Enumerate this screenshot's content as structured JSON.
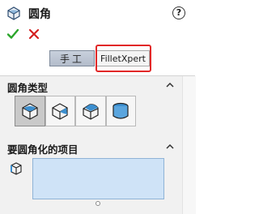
{
  "header": {
    "title": "圆角",
    "help_icon": "?",
    "title_icon": "fillet-feature-icon"
  },
  "actions": {
    "ok_icon": "checkmark-icon",
    "cancel_icon": "x-icon",
    "ok_color": "#2aa52a",
    "cancel_color": "#d42020"
  },
  "tabs": [
    {
      "label": "手工",
      "selected": true
    },
    {
      "label": "FilletXpert",
      "selected": false,
      "highlighted": true
    }
  ],
  "highlight_color": "#e12828",
  "sections": {
    "fillet_type": {
      "title": "圆角类型",
      "options": [
        {
          "icon": "constant-size-fillet-icon",
          "selected": true
        },
        {
          "icon": "variable-size-fillet-icon",
          "selected": false
        },
        {
          "icon": "face-fillet-icon",
          "selected": false
        },
        {
          "icon": "full-round-fillet-icon",
          "selected": false
        }
      ]
    },
    "items_to_fillet": {
      "title": "要圆角化的项目",
      "icon": "edge-selection-icon",
      "selection_box_color": "#cfe3f7"
    }
  }
}
